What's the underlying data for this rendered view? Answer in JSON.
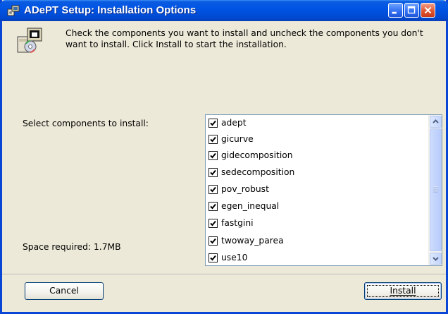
{
  "window": {
    "title": "ADePT Setup: Installation Options",
    "icon": "installer-icon",
    "controls": [
      "minimize-icon",
      "maximize-icon",
      "close-icon"
    ]
  },
  "header": {
    "icon": "software-package-icon",
    "text": "Check the components you want to install and uncheck the components you don't want to install. Click Install to start the installation."
  },
  "components": {
    "label": "Select components to install:",
    "space_required": "Space required: 1.7MB",
    "items": [
      {
        "label": "adept",
        "checked": true
      },
      {
        "label": "gicurve",
        "checked": true
      },
      {
        "label": "gidecomposition",
        "checked": true
      },
      {
        "label": "sedecomposition",
        "checked": true
      },
      {
        "label": "pov_robust",
        "checked": true
      },
      {
        "label": "egen_inequal",
        "checked": true
      },
      {
        "label": "fastgini",
        "checked": true
      },
      {
        "label": "twoway_parea",
        "checked": true
      },
      {
        "label": "use10",
        "checked": true
      }
    ]
  },
  "buttons": {
    "cancel": "Cancel",
    "install": "Install"
  },
  "colors": {
    "titlebar": "#0055e5",
    "face": "#ece9d8",
    "close_button": "#e0562f"
  }
}
